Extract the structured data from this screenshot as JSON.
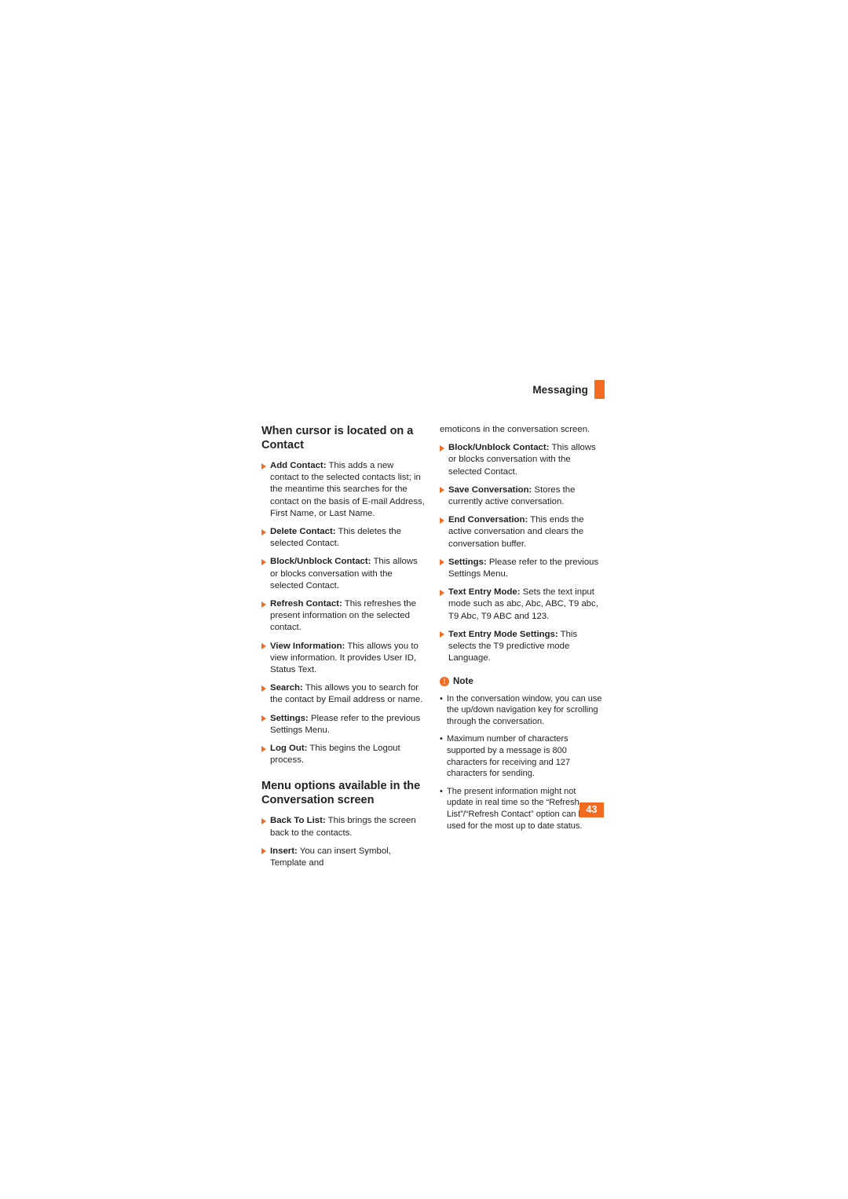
{
  "header": {
    "title": "Messaging",
    "accent_color": "#f26b21"
  },
  "page_number": "43",
  "left_column": {
    "section_title_1": "When cursor is located on a Contact",
    "items_1": [
      {
        "term": "Add Contact:",
        "text": " This adds a new contact to the selected contacts list; in the meantime this searches for the contact on the basis of E-mail Address, First Name, or Last Name."
      },
      {
        "term": "Delete Contact:",
        "text": " This deletes the selected Contact."
      },
      {
        "term": "Block/Unblock Contact:",
        "text": " This allows or blocks conversation with the selected Contact."
      },
      {
        "term": "Refresh Contact:",
        "text": " This refreshes the present information on the selected contact."
      },
      {
        "term": "View Information:",
        "text": " This allows you to view information. It provides User ID, Status Text."
      },
      {
        "term": "Search:",
        "text": " This allows you to search for the contact by Email address or name."
      },
      {
        "term": "Settings:",
        "text": " Please refer to the previous Settings Menu."
      },
      {
        "term": "Log Out:",
        "text": " This begins the Logout process."
      }
    ],
    "section_title_2": "Menu options available in the Conversation screen",
    "items_2": [
      {
        "term": "Back To List:",
        "text": " This brings the screen back to the contacts."
      },
      {
        "term": "Insert:",
        "text": " You can insert Symbol, Template and"
      }
    ]
  },
  "right_column": {
    "continuation": "emoticons in the conversation screen.",
    "items": [
      {
        "term": "Block/Unblock Contact:",
        "text": " This allows or blocks conversation with the selected Contact."
      },
      {
        "term": "Save Conversation:",
        "text": " Stores the currently active conversation."
      },
      {
        "term": "End Conversation:",
        "text": " This ends the active conversation and clears the conversation buffer."
      },
      {
        "term": "Settings:",
        "text": " Please refer to the previous Settings Menu."
      },
      {
        "term": "Text Entry Mode:",
        "text": " Sets the text input mode such as abc, Abc, ABC, T9 abc, T9 Abc, T9 ABC and 123."
      },
      {
        "term": "Text Entry Mode Settings:",
        "text": " This selects the T9 predictive mode Language."
      }
    ],
    "note": {
      "icon": "info-icon",
      "label": "Note",
      "items": [
        "In the conversation window, you can use the up/down navigation key for scrolling through the conversation.",
        "Maximum number of characters supported by a message is 800 characters for receiving and 127 characters for sending.",
        "The present information might not update in real time so the “Refresh List”/“Refresh Contact” option can be used for the most up to date status."
      ]
    }
  }
}
